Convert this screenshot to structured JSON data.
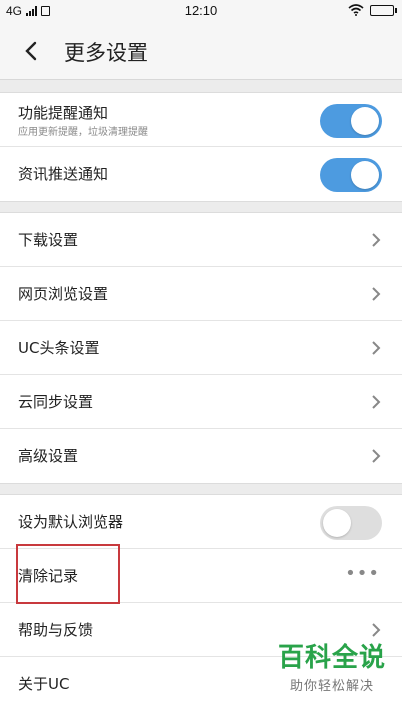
{
  "status_bar": {
    "network": "4G",
    "time": "12:10"
  },
  "header": {
    "title": "更多设置"
  },
  "notifications": [
    {
      "label": "功能提醒通知",
      "subtitle": "应用更新提醒，垃圾清理提醒",
      "toggle": true
    },
    {
      "label": "资讯推送通知",
      "toggle": true
    }
  ],
  "settings": [
    {
      "label": "下载设置"
    },
    {
      "label": "网页浏览设置"
    },
    {
      "label": "UC头条设置"
    },
    {
      "label": "云同步设置"
    },
    {
      "label": "高级设置"
    }
  ],
  "misc": {
    "default_browser": {
      "label": "设为默认浏览器",
      "toggle": false
    },
    "clear_history": {
      "label": "清除记录",
      "more": "•••"
    },
    "help": {
      "label": "帮助与反馈"
    },
    "about": {
      "label": "关于UC"
    }
  },
  "watermark": {
    "title": "百科全说",
    "subtitle": "助你轻松解决"
  },
  "colors": {
    "toggle_on": "#4d9be0",
    "highlight": "#c8393d",
    "watermark": "#29a34a"
  }
}
